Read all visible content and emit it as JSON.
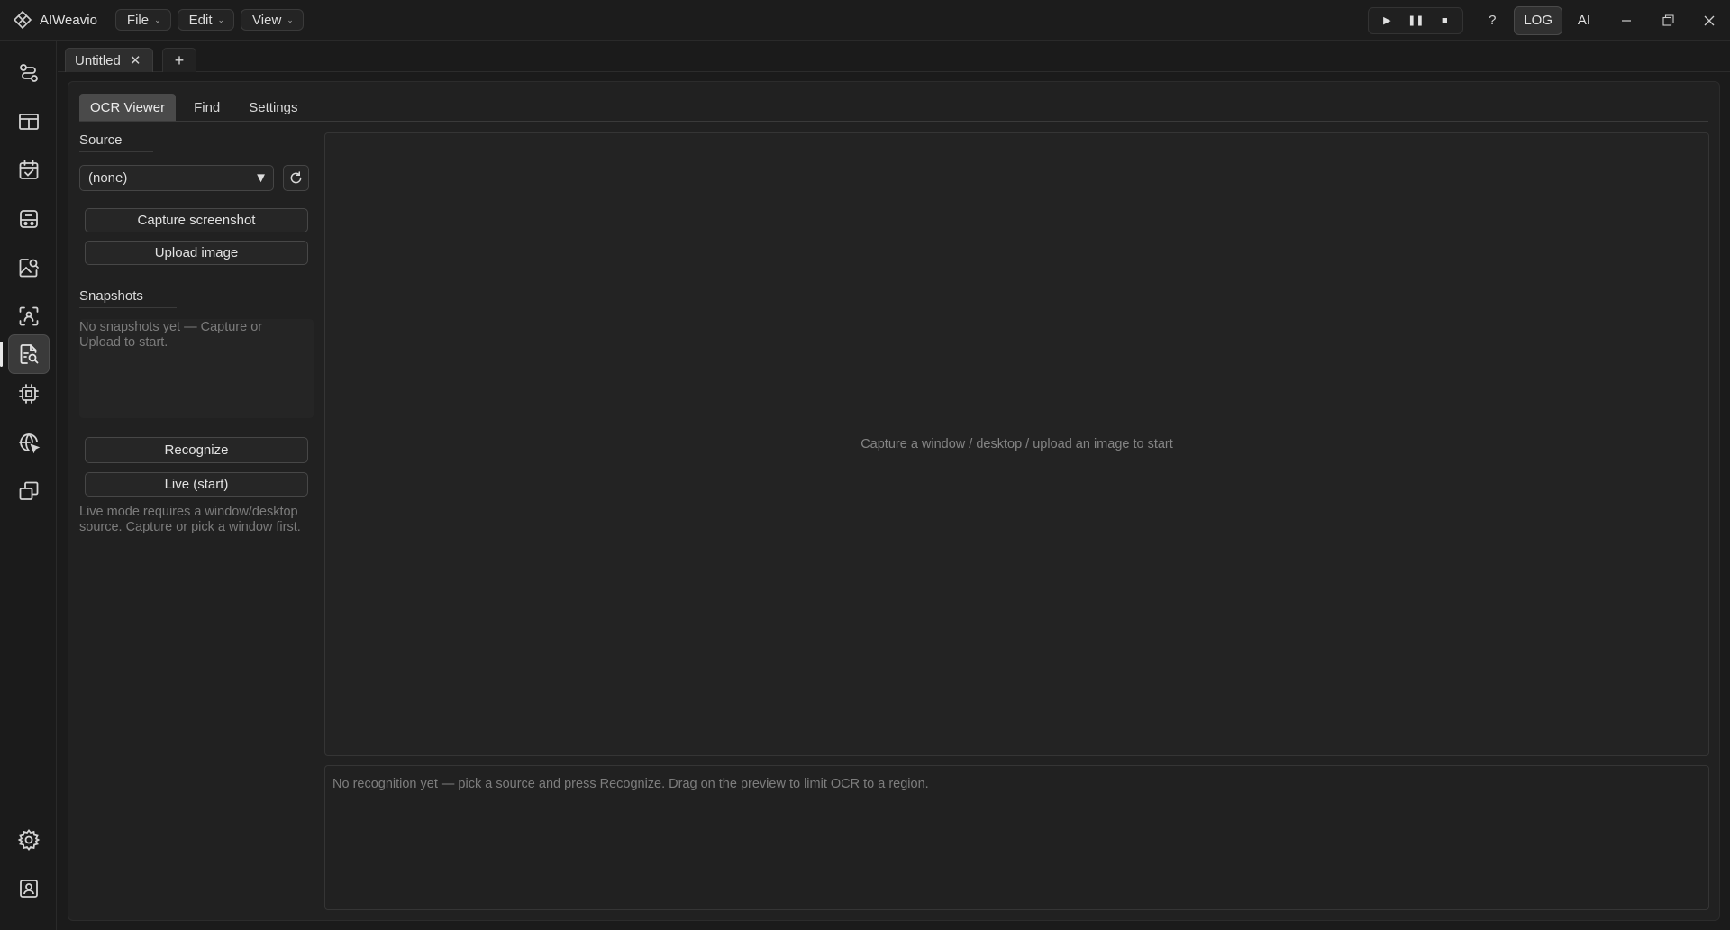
{
  "app": {
    "name": "AIWeavio",
    "menu": [
      {
        "label": "File"
      },
      {
        "label": "Edit"
      },
      {
        "label": "View"
      }
    ],
    "help_label": "?",
    "log_label": "LOG",
    "ai_label": "AI"
  },
  "document_tabs": [
    {
      "label": "Untitled",
      "close": "✕"
    }
  ],
  "add_tab_label": "+",
  "panel": {
    "tabs": [
      {
        "label": "OCR Viewer",
        "active": true
      },
      {
        "label": "Find",
        "active": false
      },
      {
        "label": "Settings",
        "active": false
      }
    ],
    "source": {
      "label": "Source",
      "selected": "(none)"
    },
    "capture_label": "Capture screenshot",
    "upload_label": "Upload image",
    "snapshots": {
      "label": "Snapshots",
      "empty_text": "No snapshots yet — Capture or Upload to start."
    },
    "recognize_label": "Recognize",
    "live_label": "Live (start)",
    "live_hint": "Live mode requires a window/desktop source. Capture or pick a window first.",
    "preview_placeholder": "Capture a window / desktop / upload an image to start",
    "output_placeholder": "No recognition yet — pick a source and press Recognize. Drag on the preview to limit OCR to a region."
  },
  "rail_icons": [
    "workflow-icon",
    "layout-icon",
    "calendar-check-icon",
    "bot-icon",
    "image-search-icon",
    "scan-face-icon",
    "ocr-document-search-icon",
    "chip-icon",
    "globe-cursor-icon",
    "windows-icon",
    "settings-icon",
    "contact-icon"
  ],
  "colors": {
    "background": "#1b1b1b",
    "panel": "#212121",
    "active_tab": "#4a4a4a",
    "text": "#d6d6d6",
    "muted_text": "#7c7c7c"
  }
}
